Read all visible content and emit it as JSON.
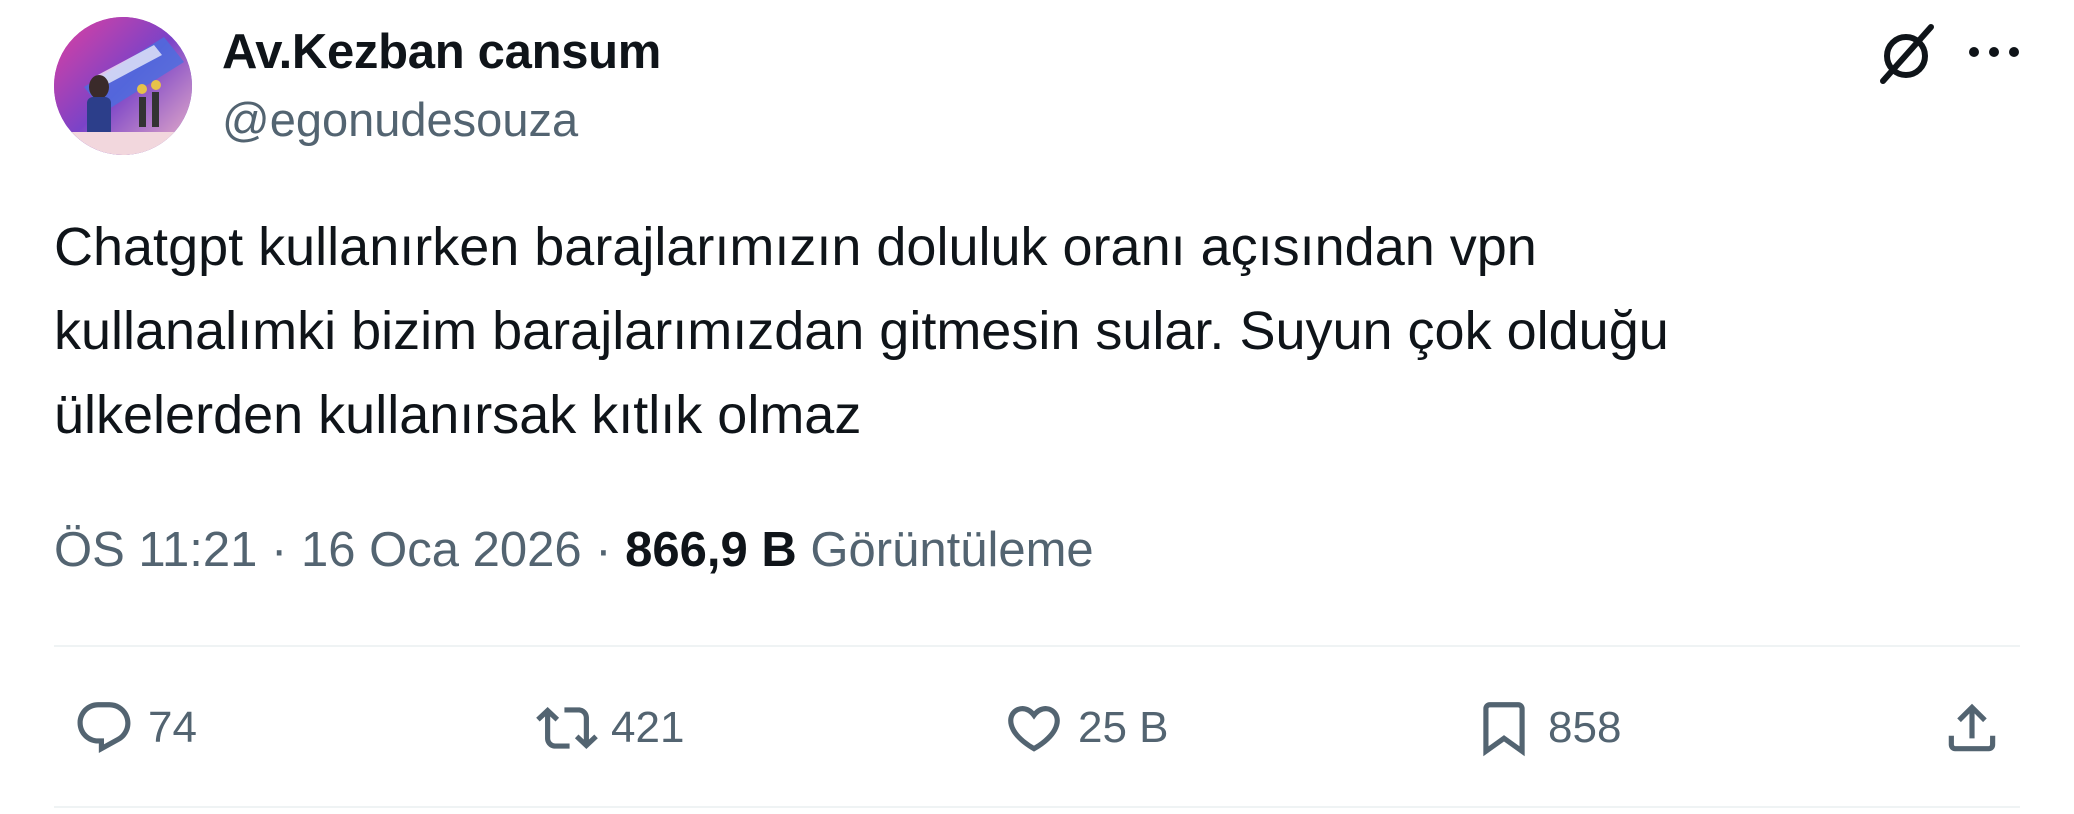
{
  "author": {
    "display_name": "Av.Kezban cansum",
    "handle": "@egonudesouza"
  },
  "tweet": {
    "text": "Chatgpt kullanırken barajlarımızın doluluk oranı açısından vpn\nkullanalımki bizim barajlarımızdan gitmesin sular. Suyun çok olduğu\nülkelerden kullanırsak kıtlık olmaz"
  },
  "meta": {
    "time": "ÖS 11:21",
    "separator": "·",
    "date": "16 Oca 2026",
    "views_count": "866,9 B",
    "views_label": "Görüntüleme"
  },
  "actions": {
    "replies": "74",
    "retweets": "421",
    "likes": "25 B",
    "bookmarks": "858"
  },
  "icons": {
    "header": [
      "grok-icon",
      "more-icon"
    ],
    "actions": [
      "reply-icon",
      "retweet-icon",
      "like-icon",
      "bookmark-icon",
      "share-icon"
    ]
  },
  "colors": {
    "text_primary": "#0f1419",
    "text_secondary": "#536471",
    "divider": "#eff3f4"
  }
}
